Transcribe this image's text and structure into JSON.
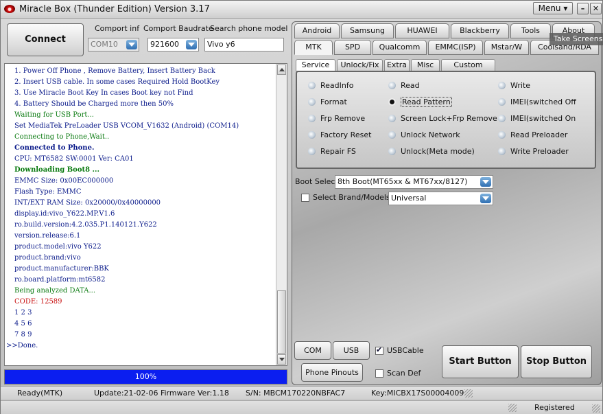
{
  "window": {
    "title": "Miracle Box (Thunder Edition) Version 3.17",
    "menu_label": "Menu ▾",
    "minimize": "–",
    "close": "✕"
  },
  "left": {
    "connect_button": "Connect Button",
    "comport_label": "Comport inf",
    "comport_value": "COM10",
    "baud_label": "Comport Baudrate",
    "baud_value": "921600",
    "search_label": "Search phone model",
    "search_value": "Vivo y6"
  },
  "log": [
    {
      "text": "1. Power Off Phone , Remove Battery, Insert Battery Back",
      "color": "#0a1a8a",
      "bold": false
    },
    {
      "text": "2. Insert USB cable. In some cases Required Hold BootKey",
      "color": "#0a1a8a",
      "bold": false
    },
    {
      "text": "3. Use Miracle Boot Key In cases Boot key not Find",
      "color": "#0a1a8a",
      "bold": false
    },
    {
      "text": "4. Battery Should be Charged more then 50%",
      "color": "#0a1a8a",
      "bold": false
    },
    {
      "text": "Waiting for USB Port...",
      "color": "#0a7a10",
      "bold": false
    },
    {
      "text": "Set MediaTek PreLoader USB VCOM_V1632 (Android) (COM14)",
      "color": "#0a1a8a",
      "bold": false
    },
    {
      "text": "Connecting to Phone,Wait..",
      "color": "#0a7a10",
      "bold": false
    },
    {
      "text": "Connected to Phone.",
      "color": "#0a1a8a",
      "bold": true
    },
    {
      "text": "CPU: MT6582 SW:0001 Ver: CA01",
      "color": "#0a1a8a",
      "bold": false
    },
    {
      "text": "Downloading Boot8 ...",
      "color": "#0a7a10",
      "bold": true
    },
    {
      "text": "EMMC Size: 0x00EC000000",
      "color": "#0a1a8a",
      "bold": false
    },
    {
      "text": "Flash Type: EMMC",
      "color": "#0a1a8a",
      "bold": false
    },
    {
      "text": "INT/EXT RAM  Size: 0x20000/0x40000000",
      "color": "#0a1a8a",
      "bold": false
    },
    {
      "text": "display.id:vivo_Y622.MP.V1.6",
      "color": "#0a1a8a",
      "bold": false
    },
    {
      "text": "ro.build.version:4.2.035.P1.140121.Y622",
      "color": "#0a1a8a",
      "bold": false
    },
    {
      "text": "version.release:6.1",
      "color": "#0a1a8a",
      "bold": false
    },
    {
      "text": "product.model:vivo Y622",
      "color": "#0a1a8a",
      "bold": false
    },
    {
      "text": "product.brand:vivo",
      "color": "#0a1a8a",
      "bold": false
    },
    {
      "text": "product.manufacturer:BBK",
      "color": "#0a1a8a",
      "bold": false
    },
    {
      "text": "ro.board.platform:mt6582",
      "color": "#0a1a8a",
      "bold": false
    },
    {
      "text": "Being analyzed DATA...",
      "color": "#0a7a10",
      "bold": false
    },
    {
      "text": "CODE: 12589",
      "color": "#c81010",
      "bold": false
    },
    {
      "text": "1 2 3",
      "color": "#0a1a8a",
      "bold": false
    },
    {
      "text": "4 5 6",
      "color": "#0a1a8a",
      "bold": false
    },
    {
      "text": "7 8 9",
      "color": "#0a1a8a",
      "bold": false
    },
    {
      "text": ">>Done.",
      "color": "#0a1a8a",
      "bold": false
    }
  ],
  "progress": {
    "value": 1.0,
    "label": "100%"
  },
  "tabs_row1": [
    "Android",
    "Samsung",
    "HUAWEI",
    "Blackberry",
    "Tools",
    "About"
  ],
  "tabs_row2": [
    "MTK",
    "SPD",
    "Qualcomm",
    "EMMC(ISP)",
    "Mstar/W",
    "Coolsand/RDA"
  ],
  "active_tab": "MTK",
  "subtabs": [
    "Service",
    "Unlock/Fix",
    "Extra",
    "Misc",
    "Custom Setting"
  ],
  "active_subtab": "Service",
  "options": {
    "col1": [
      "ReadInfo",
      "Format",
      "Frp Remove",
      "Factory Reset",
      "Repair FS"
    ],
    "col2": [
      "Read",
      "Read Pattern",
      "Screen Lock+Frp Remove",
      "Unlock Network",
      "Unlock(Meta mode)"
    ],
    "col3": [
      "Write",
      "IMEI(switched Off",
      "IMEI(switched On",
      "Read Preloader",
      "Write Preloader"
    ],
    "selected": "Read Pattern"
  },
  "boot_select": {
    "label": "Boot Select:",
    "value": "8th Boot(MT65xx & MT67xx/8127)"
  },
  "brand_select": {
    "label": "Select Brand/Models",
    "checked": false,
    "value": "Universal"
  },
  "bottom_controls": {
    "com_scan": "COM Scan",
    "usb_scan": "USB Scan",
    "usb_cable": "USBCable",
    "usb_cable_checked": true,
    "phone_pinouts": "Phone Pinouts",
    "scan_def": "Scan Def",
    "scan_def_checked": false,
    "start": "Start Button",
    "stop": "Stop Button"
  },
  "status": {
    "ready": "Ready(MTK)",
    "update": "Update:21-02-06 Firmware Ver:1.18",
    "sn": "S/N: MBCM170220NBFAC7",
    "key": "Key:MICBX17S00004009",
    "registered": "Registered"
  },
  "overlay": "Take Screenshot"
}
